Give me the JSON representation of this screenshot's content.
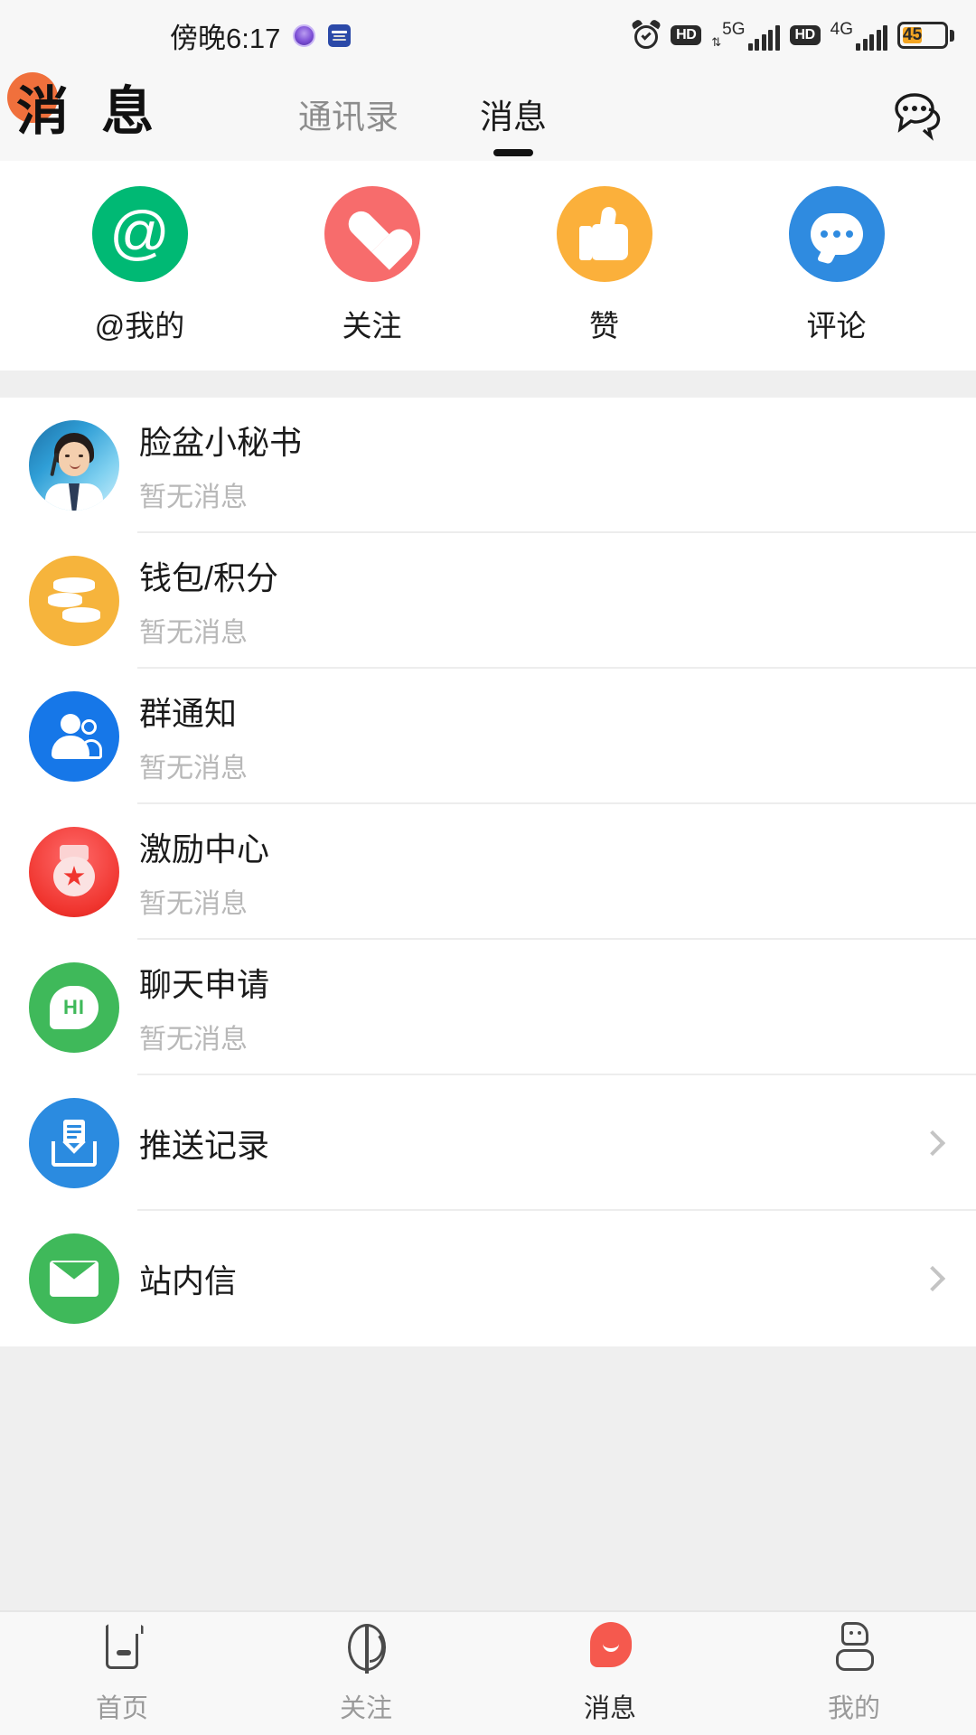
{
  "status_bar": {
    "time": "傍晚6:17",
    "alarm_icon": "alarm-clock-icon",
    "hd1_label": "HD",
    "net1_label": "5G",
    "hd2_label": "HD",
    "net2_label": "4G",
    "battery_percent": "45"
  },
  "header": {
    "brand_title": "消 息",
    "badge_color": "#F0703C",
    "tabs": [
      {
        "label": "通讯录",
        "active": false
      },
      {
        "label": "消息",
        "active": true
      }
    ],
    "chat_icon": "chat-bubbles-icon"
  },
  "quick_actions": [
    {
      "label": "@我的",
      "icon": "at-icon",
      "color": "#00B974"
    },
    {
      "label": "关注",
      "icon": "heart-plus-icon",
      "color": "#F76C6C"
    },
    {
      "label": "赞",
      "icon": "thumbs-up-icon",
      "color": "#FBB03B"
    },
    {
      "label": "评论",
      "icon": "comment-bubble-icon",
      "color": "#2F8BE0"
    }
  ],
  "message_list": [
    {
      "title": "脸盆小秘书",
      "subtitle": "暂无消息",
      "icon": "customer-service-avatar",
      "has_chevron": false
    },
    {
      "title": "钱包/积分",
      "subtitle": "暂无消息",
      "icon": "coins-icon",
      "has_chevron": false
    },
    {
      "title": "群通知",
      "subtitle": "暂无消息",
      "icon": "group-people-icon",
      "has_chevron": false
    },
    {
      "title": "激励中心",
      "subtitle": "暂无消息",
      "icon": "medal-star-icon",
      "has_chevron": false
    },
    {
      "title": "聊天申请",
      "subtitle": "暂无消息",
      "icon": "hi-bubble-icon",
      "has_chevron": false
    },
    {
      "title": "推送记录",
      "subtitle": "",
      "icon": "push-inbox-icon",
      "has_chevron": true
    },
    {
      "title": "站内信",
      "subtitle": "",
      "icon": "envelope-icon",
      "has_chevron": true
    }
  ],
  "bottom_nav": [
    {
      "label": "首页",
      "icon": "home-icon",
      "active": false
    },
    {
      "label": "关注",
      "icon": "follow-icon",
      "active": false
    },
    {
      "label": "消息",
      "icon": "message-bubble-icon",
      "active": true
    },
    {
      "label": "我的",
      "icon": "profile-icon",
      "active": false
    }
  ]
}
